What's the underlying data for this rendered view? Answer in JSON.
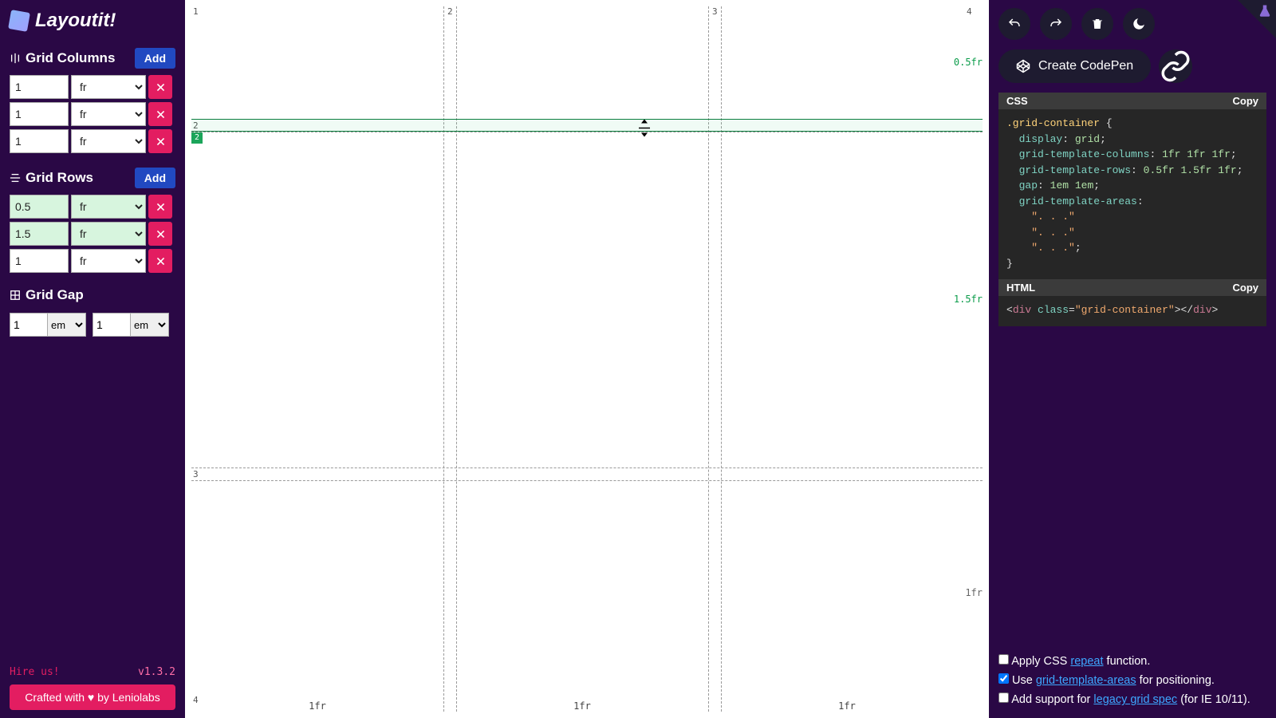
{
  "brand": "Layoutit!",
  "sections": {
    "columns_label": "Grid Columns",
    "rows_label": "Grid Rows",
    "gap_label": "Grid Gap",
    "add_label": "Add"
  },
  "columns": [
    {
      "value": "1",
      "unit": "fr"
    },
    {
      "value": "1",
      "unit": "fr"
    },
    {
      "value": "1",
      "unit": "fr"
    }
  ],
  "rows": [
    {
      "value": "0.5",
      "unit": "fr",
      "hl": true
    },
    {
      "value": "1.5",
      "unit": "fr",
      "hl": true
    },
    {
      "value": "1",
      "unit": "fr",
      "hl": false
    }
  ],
  "gap": [
    {
      "value": "1",
      "unit": "em"
    },
    {
      "value": "1",
      "unit": "em"
    }
  ],
  "grid": {
    "col_lines": [
      1,
      2,
      3,
      4
    ],
    "row_lines": [
      1,
      2,
      3,
      4
    ],
    "col_tracks": [
      "1fr",
      "1fr",
      "1fr"
    ],
    "row_tracks": [
      "0.5fr",
      "1.5fr",
      "1fr"
    ],
    "selected_row_line": 2
  },
  "footer_left": {
    "hire": "Hire us!",
    "version": "v1.3.2",
    "crafted": "Crafted with ♥ by Leniolabs"
  },
  "right": {
    "codepen_label": "Create CodePen",
    "css_label": "CSS",
    "html_label": "HTML",
    "copy_label": "Copy"
  },
  "css_code": {
    "selector": ".grid-container",
    "display": "grid",
    "grid_template_columns": "1fr 1fr 1fr",
    "grid_template_rows": "0.5fr 1.5fr 1fr",
    "gap": "1em 1em",
    "grid_template_areas": [
      "\". . .\"",
      "\". . .\"",
      "\". . .\""
    ]
  },
  "html_code": {
    "tag": "div",
    "class": "grid-container"
  },
  "checks": {
    "apply_repeat_pre": "Apply CSS ",
    "apply_repeat_link": "repeat",
    "apply_repeat_post": " function.",
    "use_areas_pre": "Use ",
    "use_areas_link": "grid-template-areas",
    "use_areas_post": " for positioning.",
    "legacy_pre": "Add support for ",
    "legacy_link": "legacy grid spec",
    "legacy_post": " (for IE 10/11).",
    "apply_repeat_checked": false,
    "use_areas_checked": true,
    "legacy_checked": false
  }
}
